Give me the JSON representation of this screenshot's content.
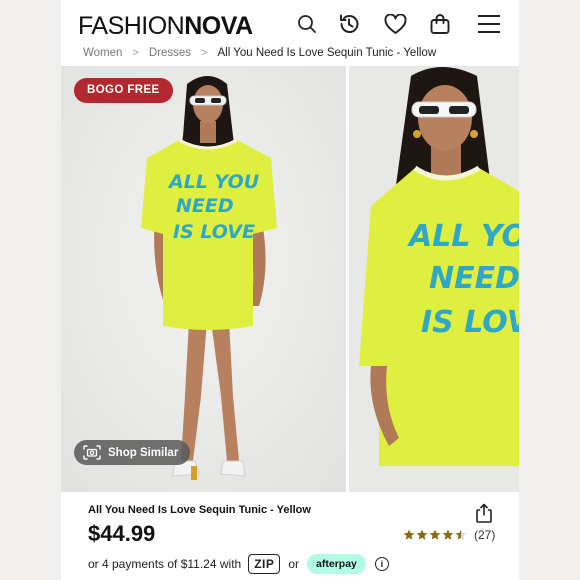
{
  "brand": {
    "logo_thin": "FASHION",
    "logo_bold": "NOVA"
  },
  "header": {
    "icons": [
      "search-icon",
      "history-icon",
      "heart-icon",
      "bag-icon",
      "menu-icon"
    ]
  },
  "breadcrumb": {
    "items": [
      "Women",
      "Dresses"
    ],
    "current": "All You Need Is Love Sequin Tunic - Yellow",
    "separator": ">"
  },
  "gallery": {
    "badge": "BOGO FREE",
    "shop_similar": "Shop Similar",
    "shirt_color": "#dfef3f",
    "print_color": "#2fa7c6",
    "shirt_text_lines": [
      "ALL YOU",
      "NEED",
      "IS LOVE"
    ]
  },
  "product": {
    "title": "All You Need Is Love Sequin Tunic - Yellow",
    "price": "$44.99",
    "rating": 4.5,
    "review_count": "(27)",
    "installments_text": "or 4 payments of $11.24 with",
    "zip_label": "ZIP",
    "or_text": "or",
    "afterpay_label": "afterpay",
    "info_label": "i"
  },
  "colors": {
    "badge": "#b3272f",
    "star": "#8a6a12",
    "afterpay": "#b2fce4"
  }
}
